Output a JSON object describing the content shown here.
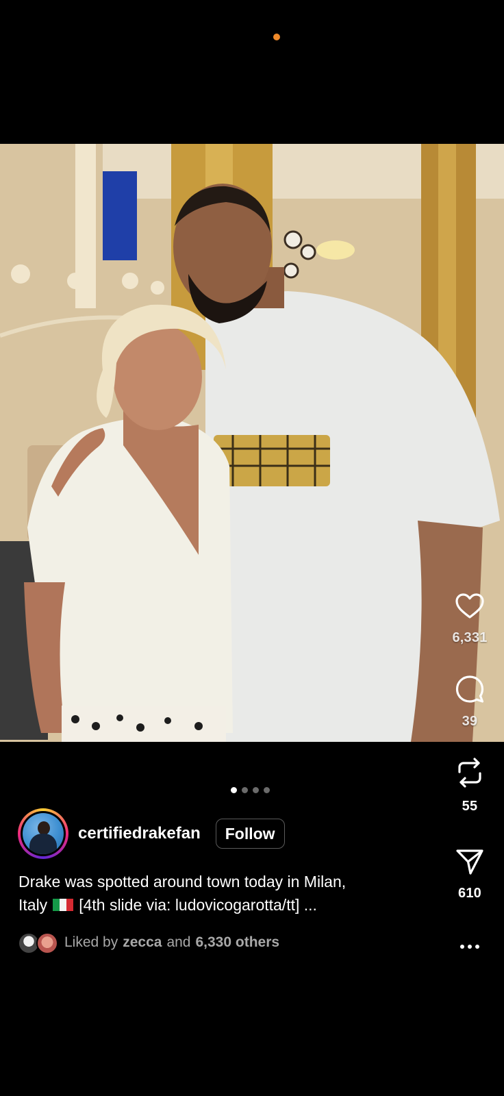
{
  "status": {
    "indicator_color": "#f08a2a"
  },
  "post": {
    "image_alt": "",
    "carousel": {
      "count": 4,
      "active_index": 0
    },
    "author": {
      "username": "certifiedrakefan",
      "follow_label": "Follow"
    },
    "caption": {
      "line1": "Drake was spotted around town today in Milan,",
      "line2_prefix": "Italy",
      "line2_suffix": "[4th slide via: ludovicogarotta/tt] ...",
      "flag_icon": "italy-flag-icon"
    },
    "likes": {
      "prefix": "Liked by",
      "first_user": "zecca",
      "joiner": "and",
      "others": "6,330 others"
    }
  },
  "actions": {
    "like": {
      "icon": "heart-icon",
      "count": "6,331"
    },
    "comment": {
      "icon": "comment-icon",
      "count": "39"
    },
    "repost": {
      "icon": "repost-icon",
      "count": "55"
    },
    "share": {
      "icon": "send-icon",
      "count": "610"
    },
    "more": {
      "icon": "more-icon"
    }
  },
  "colors": {
    "background": "#000000",
    "secondary_text": "#a8a8a8",
    "button_border": "#5b5b5b"
  }
}
